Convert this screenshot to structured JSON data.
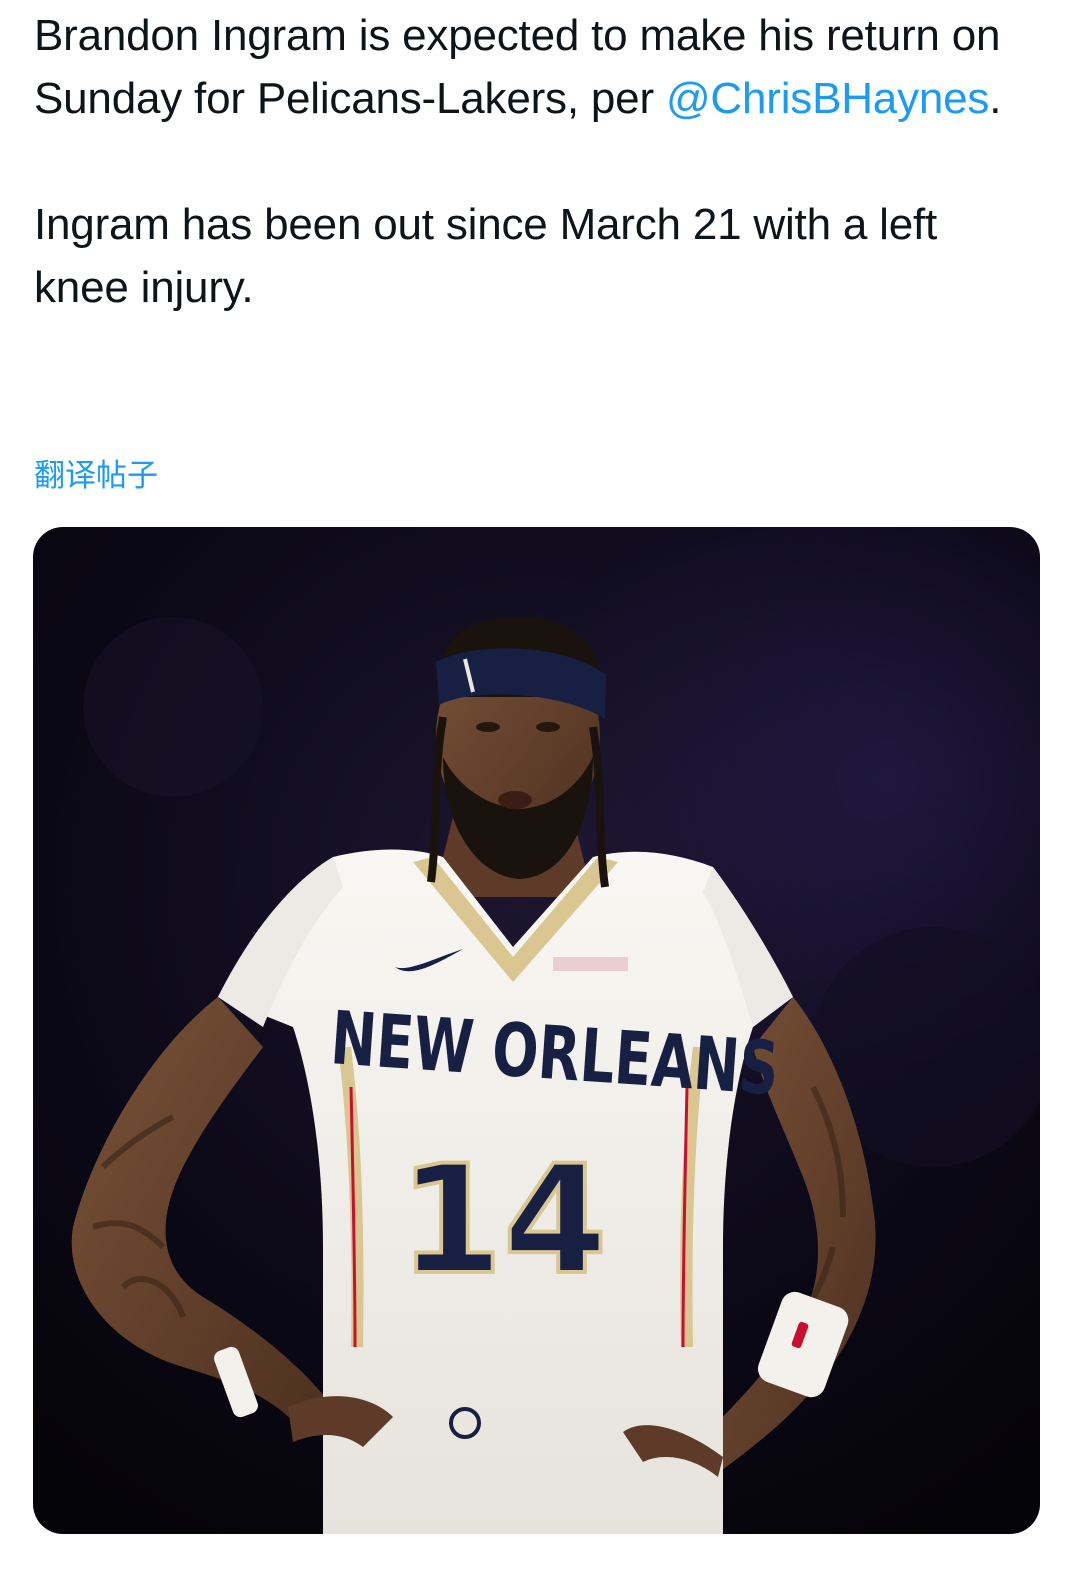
{
  "tweet": {
    "paragraph1_text": "Brandon Ingram is expected to make his return on Sunday for Pelicans-Lakers, per ",
    "mention": "@ChrisBHaynes",
    "paragraph1_end": ".",
    "paragraph2_text": "Ingram has been out since March 21 with a left knee injury."
  },
  "translate_label": "翻译帖子",
  "media": {
    "jersey_city": "NEW ORLEANS",
    "jersey_number": "14",
    "colors": {
      "background": "#0a0714",
      "jersey": "#f4f2ee",
      "trim_gold": "#d9c690",
      "navy": "#172043",
      "skin": "#6d4630"
    }
  },
  "colors": {
    "text": "#0f1419",
    "link": "#1d9bf0"
  }
}
